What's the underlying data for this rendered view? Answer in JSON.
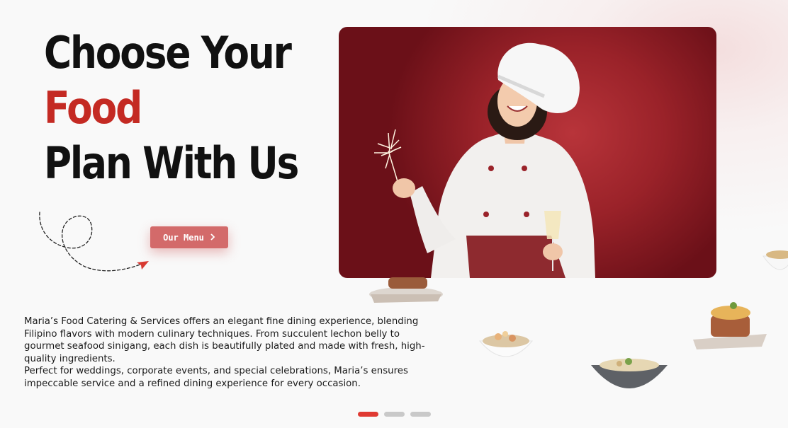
{
  "hero": {
    "title_line1": "Choose Your",
    "title_accent": "Food",
    "title_line3": "Plan With Us"
  },
  "cta": {
    "label": "Our Menu",
    "icon": "chevron-right-icon"
  },
  "description": {
    "paragraph1": "Maria’s Food Catering & Services offers an elegant fine dining experience, blending Filipino flavors with modern culinary techniques. From succulent lechon belly to gourmet seafood sinigang, each dish is beautifully plated and made with fresh, high-quality ingredients.",
    "paragraph2": "Perfect for weddings, corporate events, and special celebrations, Maria’s ensures impeccable service and a refined dining experience for every occasion."
  },
  "carousel": {
    "slides": 3,
    "active_index": 0
  },
  "colors": {
    "accent": "#c42a23",
    "button": "#d36a6a",
    "active_dot": "#e03a32",
    "inactive_dot": "#c9c9c9",
    "photo_background": "#9a2229"
  }
}
